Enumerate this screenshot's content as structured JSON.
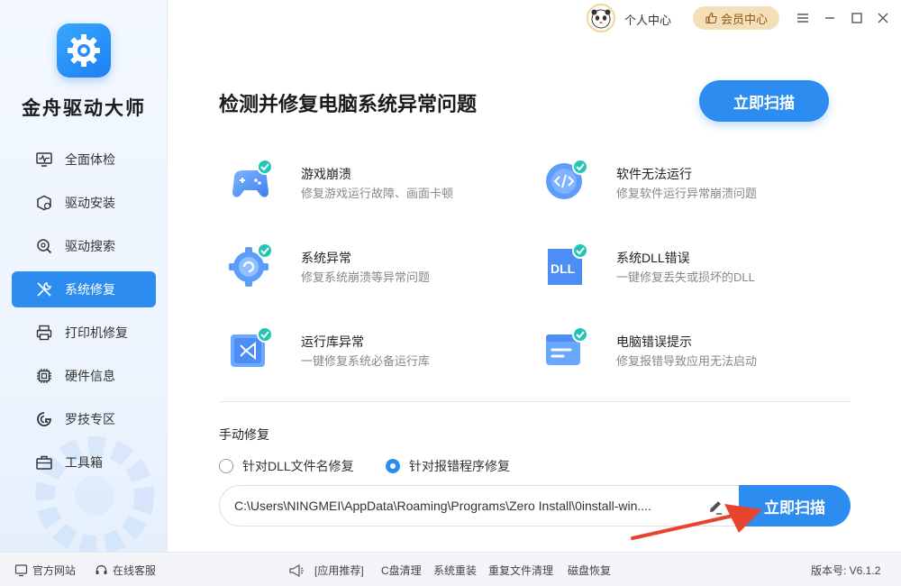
{
  "app": {
    "name": "金舟驱动大师",
    "accent": "#2d8cf0"
  },
  "topbar": {
    "personal": "个人中心",
    "member": "会员中心"
  },
  "sidebar": {
    "items": [
      {
        "label": "全面体检",
        "icon": "monitor-pulse-icon",
        "active": false
      },
      {
        "label": "驱动安装",
        "icon": "package-gear-icon",
        "active": false
      },
      {
        "label": "驱动搜索",
        "icon": "search-gear-icon",
        "active": false
      },
      {
        "label": "系统修复",
        "icon": "wrench-screwdriver-icon",
        "active": true
      },
      {
        "label": "打印机修复",
        "icon": "printer-icon",
        "active": false
      },
      {
        "label": "硬件信息",
        "icon": "chip-icon",
        "active": false
      },
      {
        "label": "罗技专区",
        "icon": "logitech-icon",
        "active": false
      },
      {
        "label": "工具箱",
        "icon": "toolbox-icon",
        "active": false
      }
    ]
  },
  "main": {
    "title": "检测并修复电脑系统异常问题",
    "scan_label": "立即扫描",
    "features": [
      {
        "title": "游戏崩溃",
        "desc": "修复游戏运行故障、画面卡顿",
        "icon": "gamepad-icon"
      },
      {
        "title": "软件无法运行",
        "desc": "修复软件运行异常崩溃问题",
        "icon": "code-icon"
      },
      {
        "title": "系统异常",
        "desc": "修复系统崩溃等异常问题",
        "icon": "gear-refresh-icon"
      },
      {
        "title": "系统DLL错误",
        "desc": "一键修复丢失或损坏的DLL",
        "icon": "dll-icon"
      },
      {
        "title": "运行库异常",
        "desc": "一键修复系统必备运行库",
        "icon": "visual-studio-icon"
      },
      {
        "title": "电脑错误提示",
        "desc": "修复报错导致应用无法启动",
        "icon": "error-window-icon"
      }
    ],
    "manual": {
      "title": "手动修复",
      "option_dll": "针对DLL文件名修复",
      "option_program": "针对报错程序修复",
      "path_value": "C:\\Users\\NINGMEI\\AppData\\Roaming\\Programs\\Zero Install\\0install-win....",
      "scan_label": "立即扫描"
    }
  },
  "footer": {
    "website": "官方网站",
    "support": "在线客服",
    "recommend": "[应用推荐]",
    "links": [
      "C盘清理",
      "系统重装",
      "重复文件清理",
      "磁盘恢复"
    ],
    "version": "版本号: V6.1.2"
  }
}
